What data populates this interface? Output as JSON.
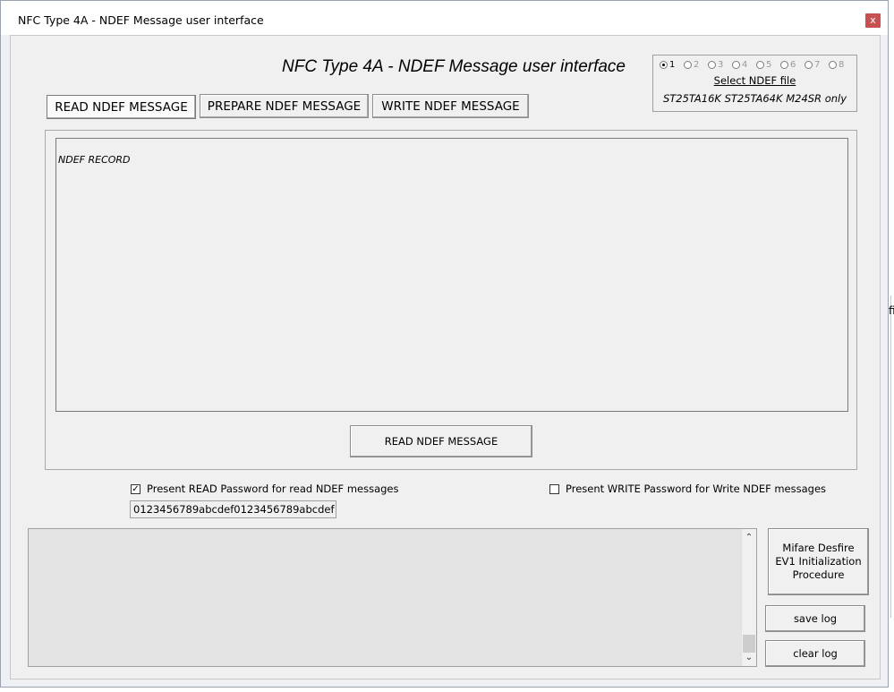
{
  "window": {
    "title": "NFC Type 4A - NDEF Message user interface",
    "close_glyph": "x"
  },
  "header": {
    "title": "NFC Type 4A - NDEF Message user interface"
  },
  "ndef_file": {
    "options": [
      "1",
      "2",
      "3",
      "4",
      "5",
      "6",
      "7",
      "8"
    ],
    "selected": "1",
    "select_label": "Select NDEF file",
    "note": "ST25TA16K ST25TA64K M24SR only"
  },
  "tabs": [
    {
      "label": "READ NDEF MESSAGE",
      "active": true
    },
    {
      "label": "PREPARE NDEF MESSAGE",
      "active": false
    },
    {
      "label": "WRITE NDEF MESSAGE",
      "active": false
    }
  ],
  "record": {
    "label": "NDEF RECORD",
    "value": ""
  },
  "actions": {
    "read_button": "READ NDEF MESSAGE"
  },
  "password": {
    "read_checkbox_label": "Present READ Password for read NDEF messages",
    "read_checked": true,
    "write_checkbox_label": "Present WRITE Password for Write NDEF messages",
    "write_checked": false,
    "read_value": "0123456789abcdef0123456789abcdef"
  },
  "log": {
    "content": ""
  },
  "side_buttons": {
    "mifare": "Mifare Desfire EV1 Initialization Procedure",
    "save_log": "save log",
    "clear_log": "clear log"
  },
  "edge_text": "fi"
}
